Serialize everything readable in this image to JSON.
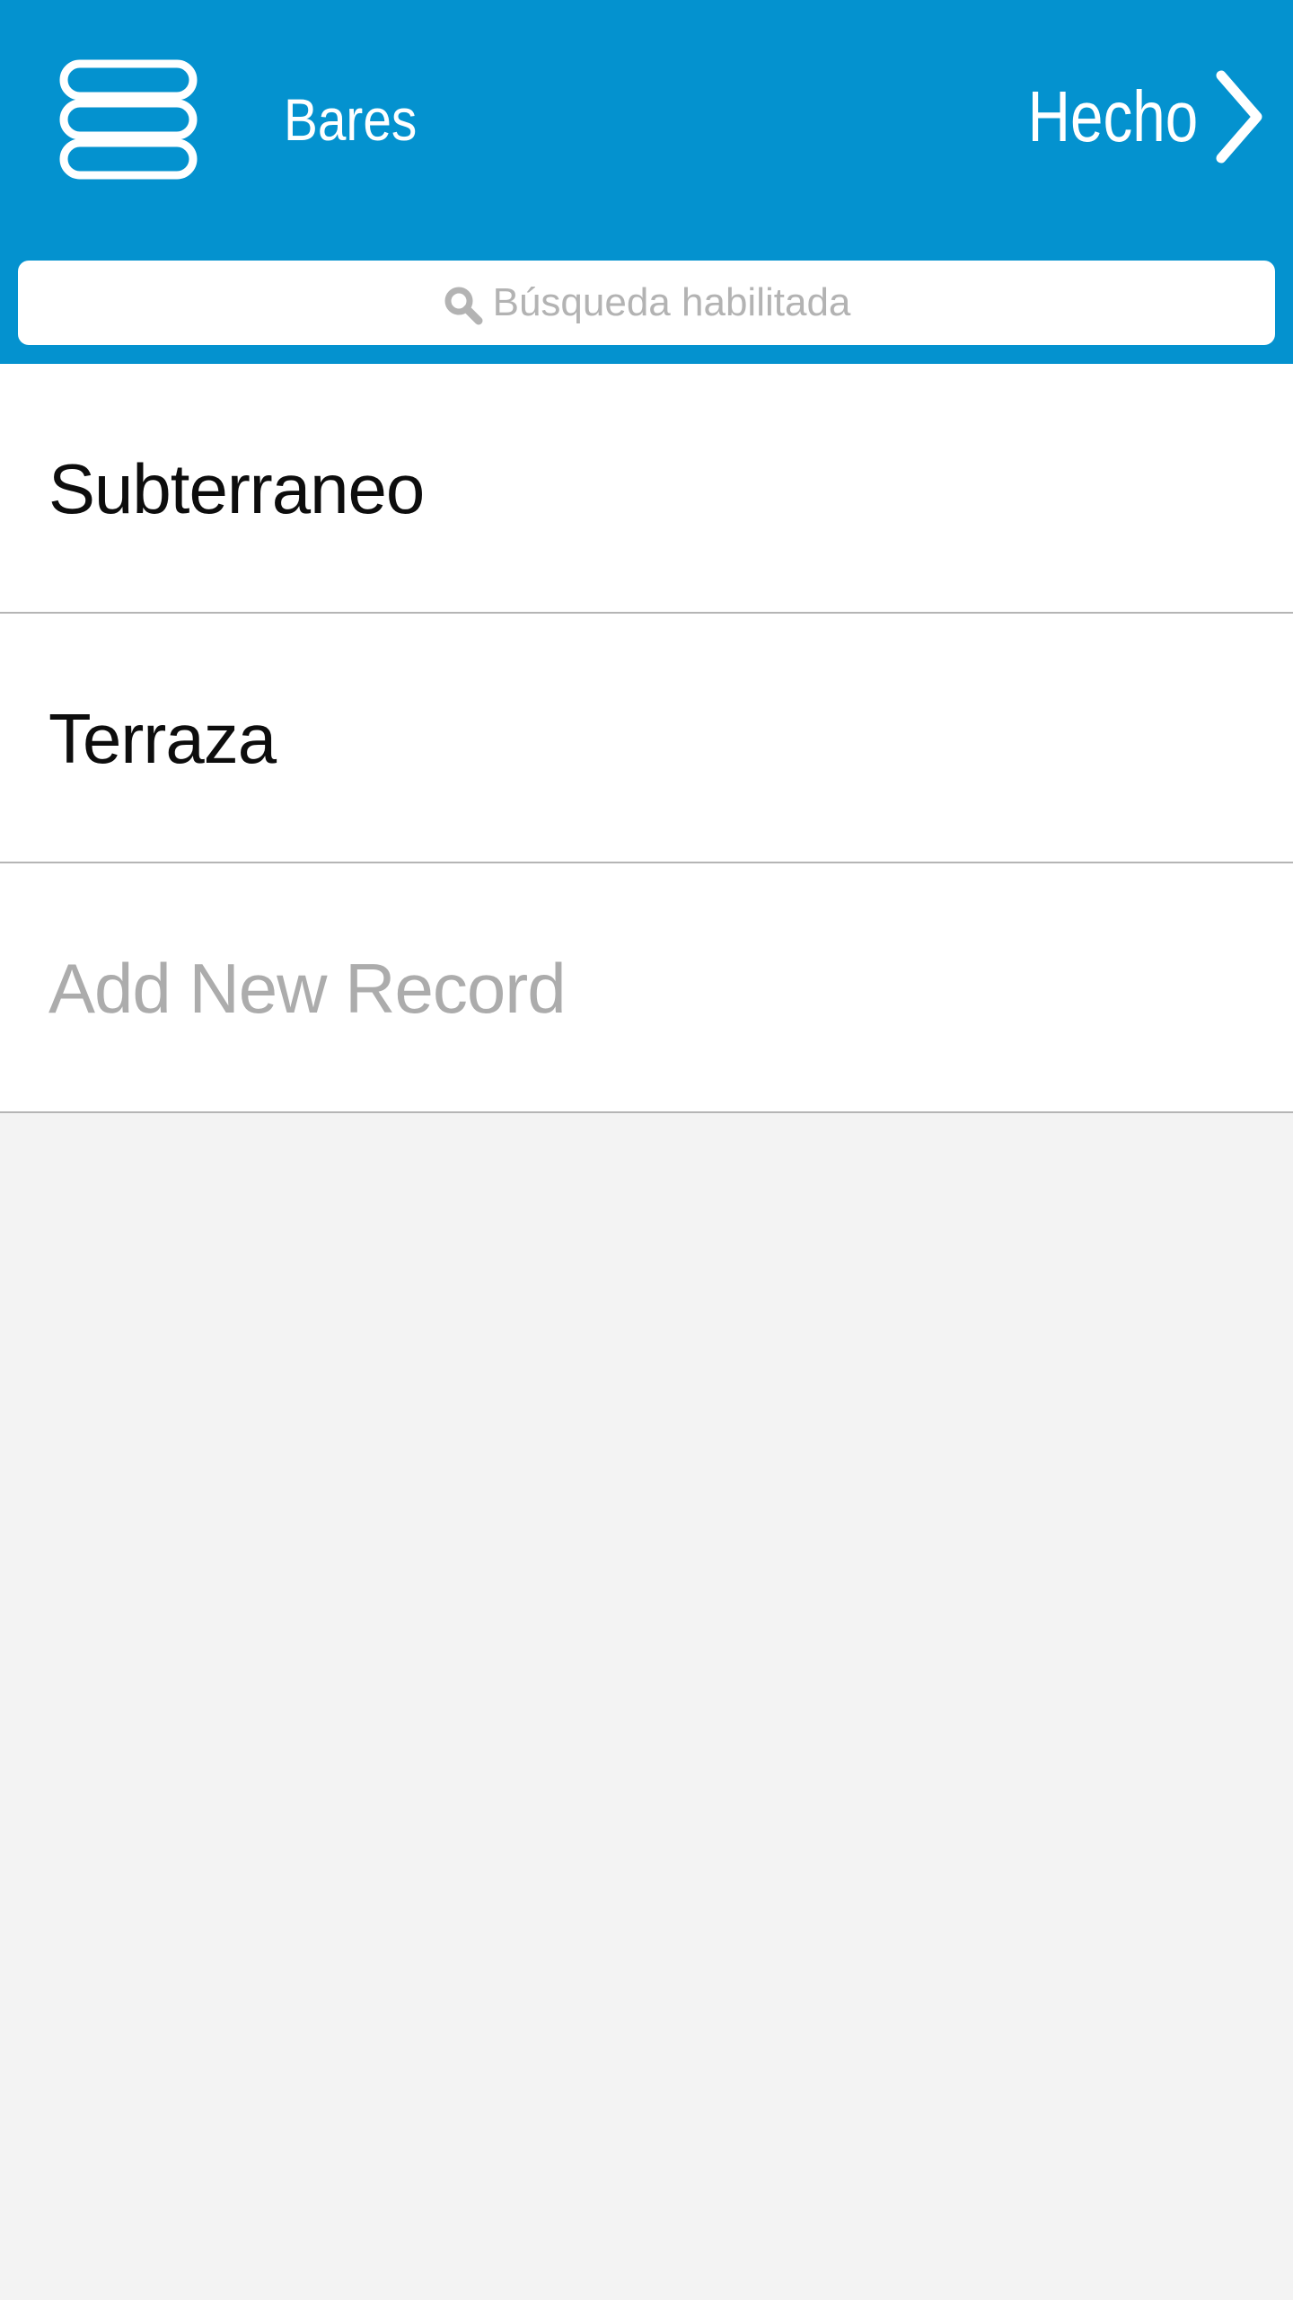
{
  "header": {
    "title": "Bares",
    "done_label": "Hecho",
    "background_color": "#0492cf",
    "left_icon": "database-icon",
    "right_icon": "chevron-right-icon"
  },
  "search": {
    "placeholder": "Búsqueda habilitada",
    "icon": "search-icon"
  },
  "list": {
    "items": [
      {
        "label": "Subterraneo"
      },
      {
        "label": "Terraza"
      }
    ],
    "add_label": "Add New Record"
  }
}
